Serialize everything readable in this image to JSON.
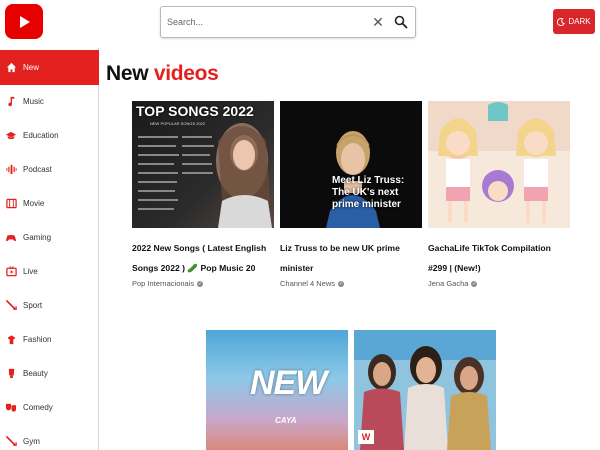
{
  "header": {
    "search_placeholder": "Search...",
    "dark_label": "DARK"
  },
  "sidebar": {
    "items": [
      {
        "label": "New",
        "icon": "home-icon"
      },
      {
        "label": "Music",
        "icon": "music-note-icon"
      },
      {
        "label": "Education",
        "icon": "graduation-cap-icon"
      },
      {
        "label": "Podcast",
        "icon": "podcast-icon"
      },
      {
        "label": "Movie",
        "icon": "movie-icon"
      },
      {
        "label": "Gaming",
        "icon": "gamepad-icon"
      },
      {
        "label": "Live",
        "icon": "live-tv-icon"
      },
      {
        "label": "Sport",
        "icon": "sport-icon"
      },
      {
        "label": "Fashion",
        "icon": "hanger-icon"
      },
      {
        "label": "Beauty",
        "icon": "beauty-icon"
      },
      {
        "label": "Comedy",
        "icon": "comedy-icon"
      },
      {
        "label": "Gym",
        "icon": "dumbbell-icon"
      }
    ]
  },
  "main": {
    "title_word1": "New",
    "title_word2": "videos",
    "videos": [
      {
        "title": "2022 New Songs ( Latest English Songs 2022 ) 🥒 Pop Music 20",
        "channel": "Pop Internacionais",
        "thumb_text": "TOP SONGS 2022",
        "thumb_sub": "NEW POPULAR SONGS 2022"
      },
      {
        "title": "Liz Truss to be new UK prime minister",
        "channel": "Channel 4 News",
        "thumb_text": "Meet Liz Truss: The UK's next prime minister"
      },
      {
        "title": "GachaLife TikTok Compilation #299 | (New!)",
        "channel": "Jena Gacha"
      },
      {
        "thumb_text": "NEW",
        "thumb_sub": "CAYA"
      },
      {
        "thumb_logo": "W"
      }
    ]
  },
  "colors": {
    "brand_red": "#e3221f",
    "sidebar_active": "#e3221f"
  }
}
